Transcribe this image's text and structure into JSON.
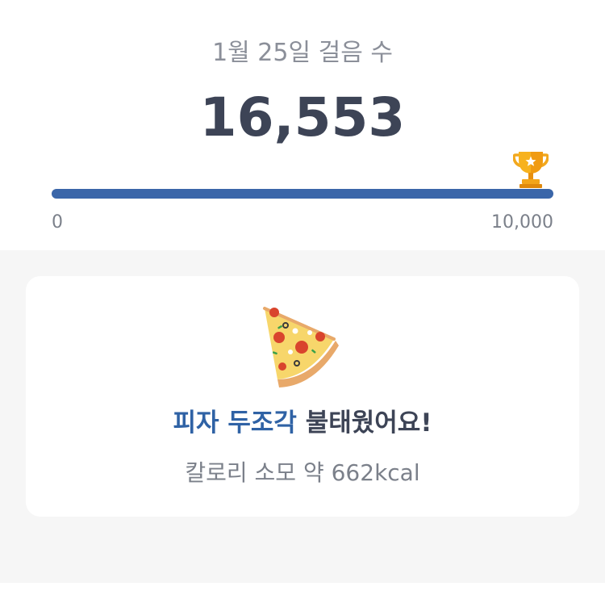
{
  "summary": {
    "date_label": "1월 25일 걸음 수",
    "steps": "16,553",
    "progress_fraction": 1.0,
    "goal_min": "0",
    "goal_max": "10,000"
  },
  "food_card": {
    "food_highlight": "피자 두조각",
    "burned_text": " 불태웠어요!",
    "calorie_text": "칼로리 소모 약 662kcal",
    "icon": "pizza-slice-icon"
  },
  "trophy": {
    "icon": "trophy-icon"
  },
  "colors": {
    "accent": "#2f62a5",
    "progress_fill": "#3a66a9",
    "text_dark": "#3d4456",
    "text_muted": "#7b808a",
    "background_gray": "#f6f6f6"
  }
}
